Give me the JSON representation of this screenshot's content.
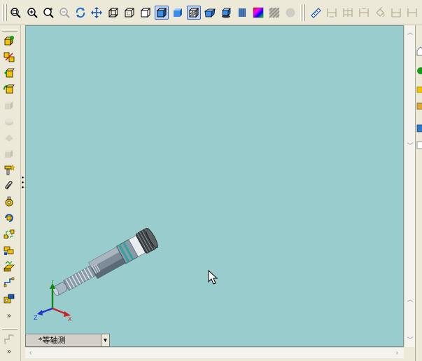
{
  "toolbar": {
    "buttons": [
      {
        "id": "zoom-window",
        "icon": "zoom-window-icon"
      },
      {
        "id": "zoom-in",
        "icon": "zoom-in-icon"
      },
      {
        "id": "zoom-area",
        "icon": "zoom-area-icon"
      },
      {
        "id": "zoom-out",
        "icon": "zoom-out-icon",
        "disabled": true
      },
      {
        "id": "rotate",
        "icon": "rotate-icon"
      },
      {
        "id": "pan",
        "icon": "pan-icon"
      },
      {
        "id": "wireframe",
        "icon": "wireframe-icon"
      },
      {
        "id": "hidden-lines-visible",
        "icon": "hidden-lines-visible-icon"
      },
      {
        "id": "hidden-lines-removed",
        "icon": "hidden-lines-removed-icon"
      },
      {
        "id": "shaded-with-edges",
        "icon": "shaded-with-edges-icon",
        "active": true
      },
      {
        "id": "shaded",
        "icon": "shaded-icon"
      },
      {
        "id": "section-view",
        "icon": "section-view-icon",
        "active": true
      },
      {
        "id": "perspective",
        "icon": "perspective-icon"
      },
      {
        "id": "shadows",
        "icon": "shadows-icon"
      },
      {
        "id": "appearance",
        "icon": "appearance-icon"
      },
      {
        "id": "texture",
        "icon": "texture-icon",
        "disabled": true
      },
      {
        "id": "realview",
        "icon": "realview-icon",
        "disabled": true
      },
      {
        "id": "measure",
        "icon": "measure-icon"
      },
      {
        "id": "dimension-1",
        "icon": "dimension-icon",
        "disabled": true
      },
      {
        "id": "dimension-2",
        "icon": "dimension-icon",
        "disabled": true
      },
      {
        "id": "dimension-3",
        "icon": "dimension-icon",
        "disabled": true
      },
      {
        "id": "paint",
        "icon": "paint-icon",
        "disabled": true
      },
      {
        "id": "dimension-4",
        "icon": "dimension-icon",
        "disabled": true
      },
      {
        "id": "dimension-5",
        "icon": "dimension-icon",
        "disabled": true
      }
    ]
  },
  "left_toolbar": {
    "buttons": [
      {
        "id": "insert-component",
        "icon": "insert-component-icon"
      },
      {
        "id": "mate",
        "icon": "mate-icon"
      },
      {
        "id": "move-component",
        "icon": "move-component-icon"
      },
      {
        "id": "rotate-component",
        "icon": "rotate-component-icon"
      },
      {
        "id": "assembly-disabled-1",
        "icon": "assembly-icon",
        "disabled": true
      },
      {
        "id": "assembly-disabled-2",
        "icon": "assembly-icon",
        "disabled": true
      },
      {
        "id": "assembly-disabled-3",
        "icon": "assembly-icon",
        "disabled": true
      },
      {
        "id": "assembly-disabled-4",
        "icon": "assembly-icon",
        "disabled": true
      },
      {
        "id": "smart-fasteners",
        "icon": "smart-fasteners-icon"
      },
      {
        "id": "clip",
        "icon": "paperclip-icon"
      },
      {
        "id": "explode",
        "icon": "explode-icon"
      },
      {
        "id": "explode-line",
        "icon": "explode-line-icon"
      },
      {
        "id": "interference",
        "icon": "interference-icon"
      },
      {
        "id": "hole-series",
        "icon": "hole-series-icon"
      },
      {
        "id": "pattern",
        "icon": "pattern-icon"
      },
      {
        "id": "route",
        "icon": "route-icon"
      },
      {
        "id": "weld",
        "icon": "weld-icon"
      }
    ],
    "more_label": "»"
  },
  "viewport": {
    "background": "#99cccc",
    "view_name": "*等轴测",
    "triad": {
      "x_label": "X",
      "y_label": "Y",
      "z_label": "Z"
    }
  },
  "colors": {
    "x_axis": "#cc2222",
    "y_axis": "#118811",
    "z_axis": "#2233cc",
    "model_body": "#8a9aa8",
    "model_teal": "#2aa6a0"
  }
}
